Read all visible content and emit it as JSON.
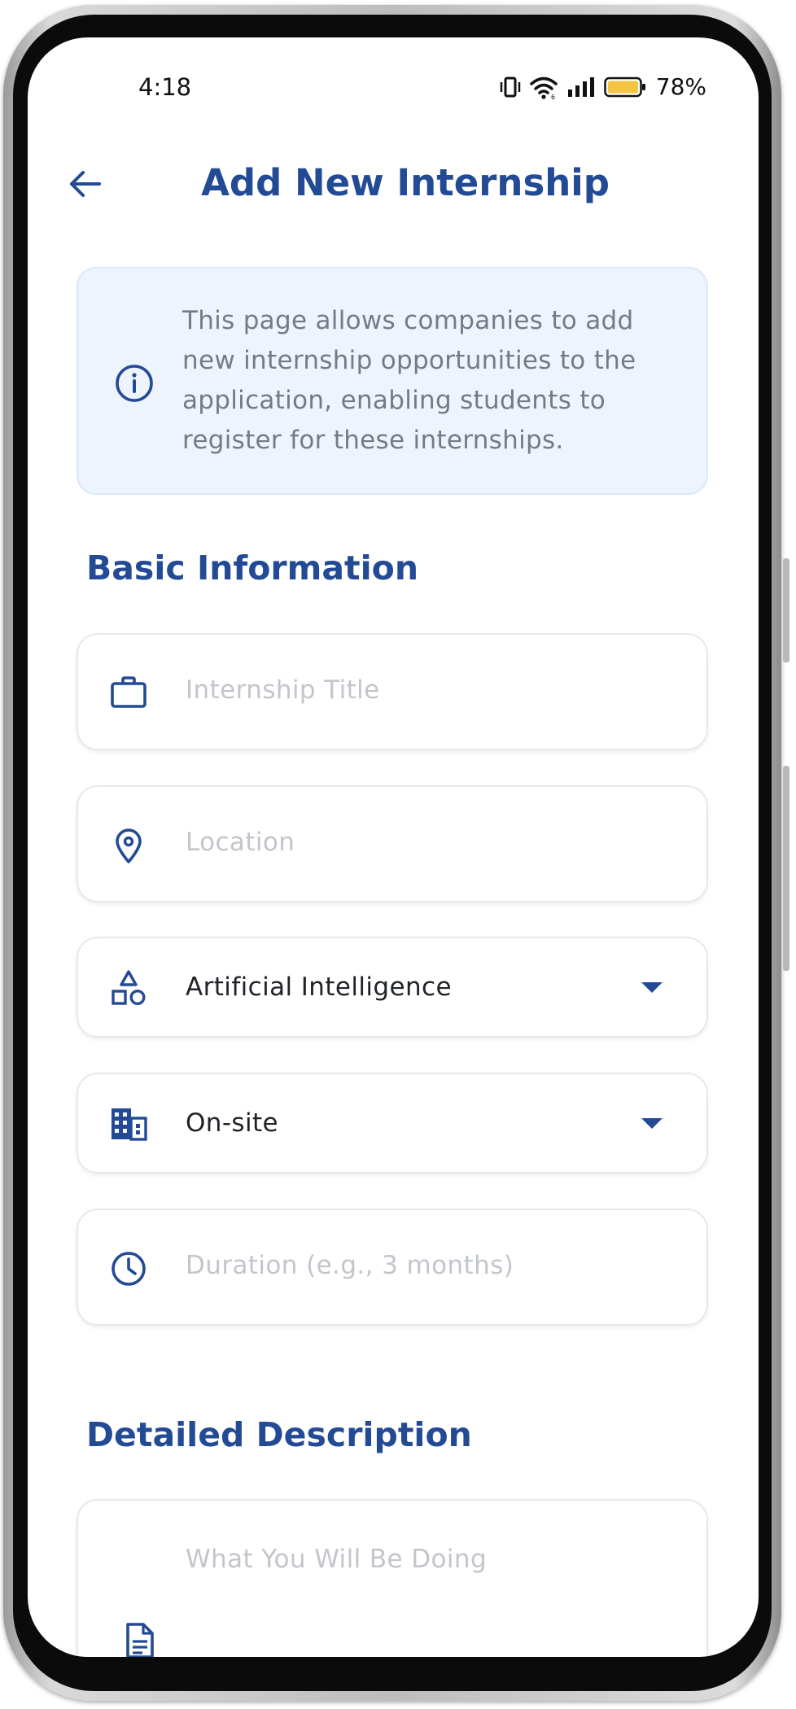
{
  "status_bar": {
    "time": "4:18",
    "battery_percent": "78%",
    "icons": [
      "vibrate-icon",
      "wifi-icon",
      "signal-icon",
      "battery-icon"
    ]
  },
  "header": {
    "title": "Add New Internship",
    "back_icon": "arrow-left-icon"
  },
  "info_box": {
    "icon": "info-circle-icon",
    "text": "This page allows companies to add new internship opportunities to the application, enabling students to register for these internships."
  },
  "sections": {
    "basic_information": "Basic Information",
    "detailed_description": "Detailed Description"
  },
  "form": {
    "internship_title": {
      "placeholder": "Internship Title",
      "value": "",
      "icon": "briefcase-icon"
    },
    "location": {
      "placeholder": "Location",
      "value": "",
      "icon": "location-pin-icon"
    },
    "category": {
      "value": "Artificial Intelligence",
      "icon": "shapes-icon"
    },
    "work_mode": {
      "value": "On-site",
      "icon": "building-icon"
    },
    "duration": {
      "placeholder": "Duration (e.g., 3 months)",
      "value": "",
      "icon": "clock-icon"
    },
    "what_you_will_be_doing": {
      "placeholder": "What You Will Be Doing",
      "value": "",
      "icon": "document-icon"
    }
  },
  "colors": {
    "accent": "#234a95",
    "info_bg": "#eef4fe",
    "placeholder": "#c2c5cb"
  }
}
